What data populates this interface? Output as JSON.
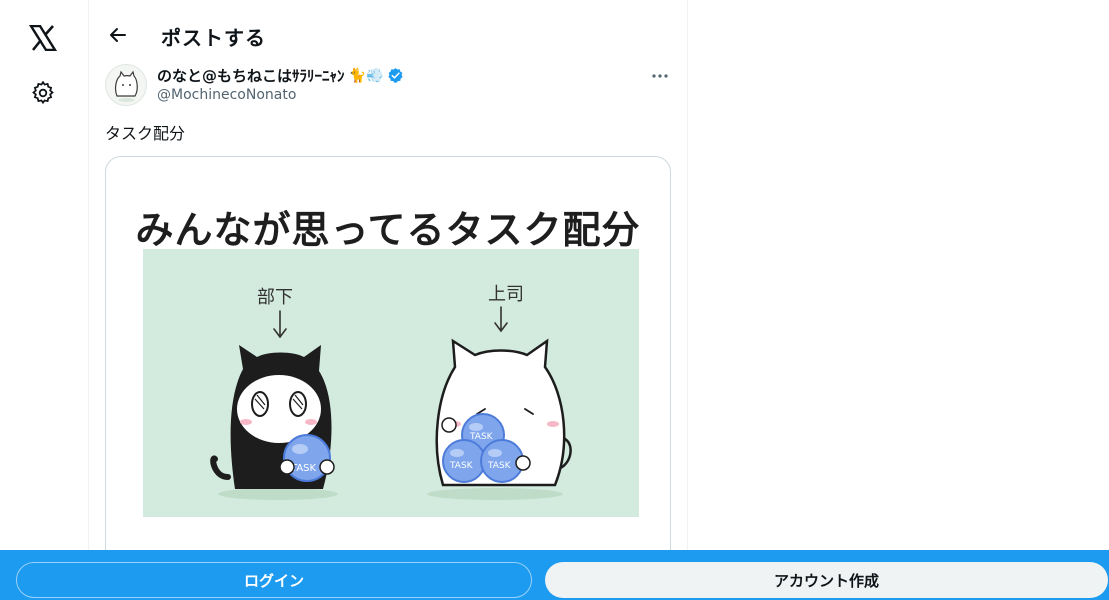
{
  "nav": {
    "logo_icon": "x-logo-icon",
    "settings_icon": "gear-icon"
  },
  "header": {
    "title": "ポストする",
    "back_icon": "arrow-left-icon"
  },
  "post": {
    "author": {
      "display_name": "のなと@もちねこはｻﾗﾘｰﾆｬﾝ",
      "emoji": "🐈💨",
      "handle": "@MochinecoNonato",
      "verified": true
    },
    "text": "タスク配分",
    "media": {
      "title": "みんなが思ってるタスク配分",
      "labels": {
        "left": "部下",
        "right": "上司"
      },
      "task_label": "TASK"
    }
  },
  "bottom_bar": {
    "login_label": "ログイン",
    "signup_label": "アカウント作成"
  },
  "colors": {
    "accent": "#1d9bf0",
    "verified": "#1d9bf0",
    "illustration_bg": "#d3ebdf"
  }
}
